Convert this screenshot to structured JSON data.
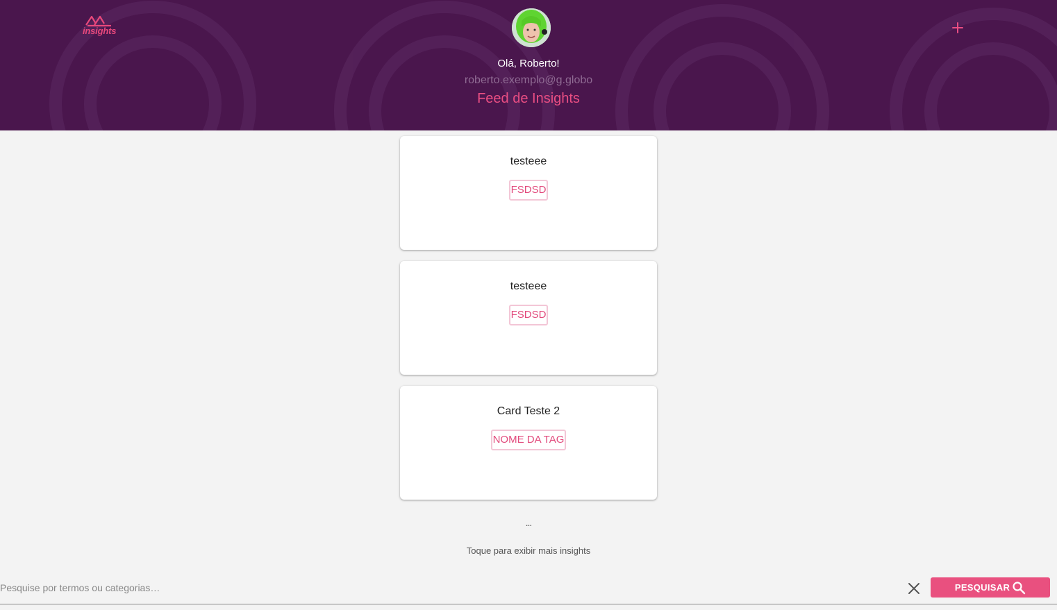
{
  "header": {
    "logo_text": "insights",
    "greeting": "Olá, Roberto!",
    "email": "roberto.exemplo@g.globo",
    "page_title": "Feed de Insights",
    "accent_color": "#ea4e83",
    "background_color": "#4a164d"
  },
  "icons": {
    "add": "plus-icon",
    "clear": "close-icon",
    "search": "search-icon"
  },
  "cards": [
    {
      "title": "testeee",
      "tag": "FSDSD"
    },
    {
      "title": "testeee",
      "tag": "FSDSD"
    },
    {
      "title": "Card Teste 2",
      "tag": "NOME DA TAG"
    }
  ],
  "feed": {
    "ellipsis": "...",
    "load_more": "Toque para exibir mais insights"
  },
  "search": {
    "placeholder": "Pesquise por termos ou categorias…",
    "value": "",
    "button_label": "PESQUISAR"
  }
}
